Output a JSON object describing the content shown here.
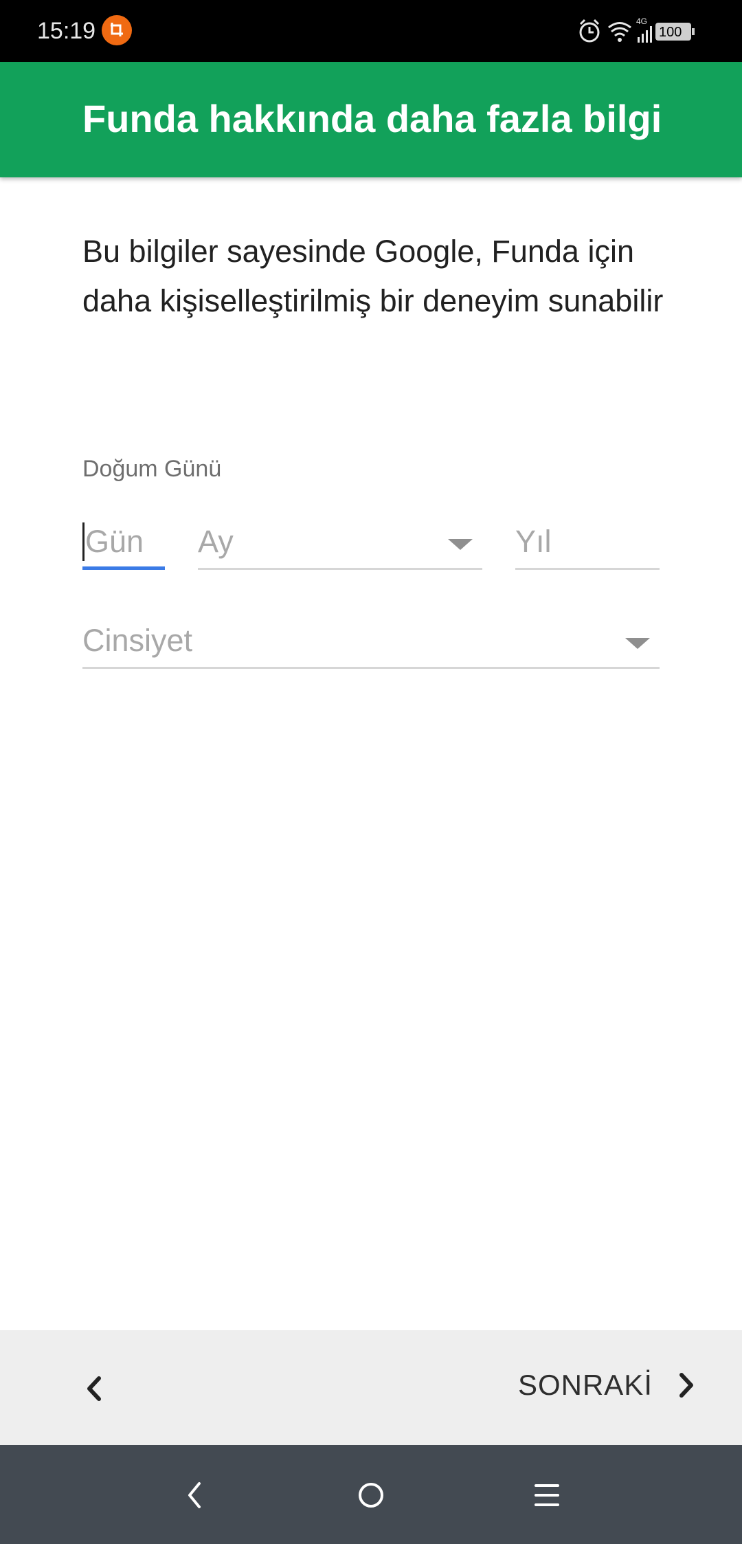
{
  "status_bar": {
    "time": "15:19",
    "network": "4G",
    "battery": "100",
    "icons": [
      "screenshot-app-icon",
      "alarm-icon",
      "wifi-icon",
      "signal-icon",
      "battery-icon"
    ]
  },
  "header": {
    "title": "Funda hakkında daha fazla bilgi",
    "background_color": "#12a15a"
  },
  "intro": {
    "text": "Bu bilgiler sayesinde Google, Funda için daha kişiselleştirilmiş bir deneyim sunabilir"
  },
  "birthday": {
    "label": "Doğum Günü",
    "day_placeholder": "Gün",
    "month_placeholder": "Ay",
    "year_placeholder": "Yıl",
    "focus_color": "#3b7be6"
  },
  "gender": {
    "placeholder": "Cinsiyet"
  },
  "wizard_nav": {
    "next_label": "SONRAKİ",
    "prev_icon": "chevron-left-icon",
    "next_icon": "chevron-right-icon"
  },
  "system_nav": {
    "icons": [
      "back-icon",
      "home-icon",
      "menu-icon"
    ]
  }
}
